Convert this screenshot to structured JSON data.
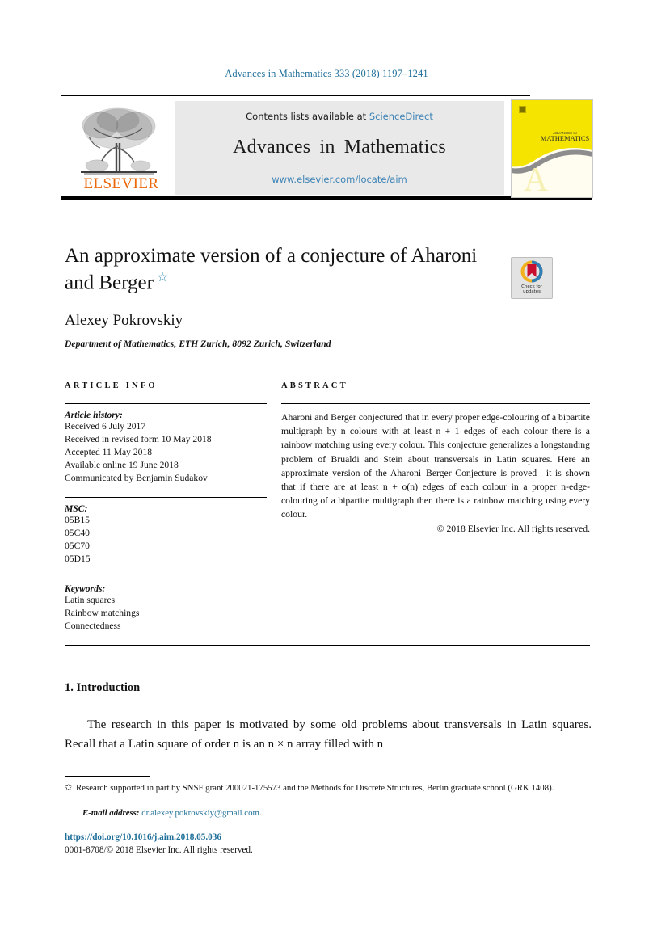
{
  "running_head": "Advances in Mathematics 333 (2018) 1197–1241",
  "masthead": {
    "contents_prefix": "Contents lists available at ",
    "sciencedirect_link": "ScienceDirect",
    "journal_name": "Advances in Mathematics",
    "journal_url": "www.elsevier.com/locate/aim",
    "publisher_logo_text": "ELSEVIER",
    "cover_title_small": "ADVANCES IN",
    "cover_title_main": "MATHEMATICS"
  },
  "article": {
    "title": "An approximate version of a conjecture of Aharoni and Berger",
    "title_footnote_marker": "☆",
    "author": "Alexey Pokrovskiy",
    "affiliation": "Department of Mathematics, ETH Zurich, 8092 Zurich, Switzerland",
    "crossmark_label_line1": "Check for",
    "crossmark_label_line2": "updates"
  },
  "article_info": {
    "heading": "ARTICLE INFO",
    "history_label": "Article history:",
    "history": [
      "Received 6 July 2017",
      "Received in revised form 10 May 2018",
      "Accepted 11 May 2018",
      "Available online 19 June 2018",
      "Communicated by Benjamin Sudakov"
    ],
    "msc_label": "MSC:",
    "msc": [
      "05B15",
      "05C40",
      "05C70",
      "05D15"
    ],
    "keywords_label": "Keywords:",
    "keywords": [
      "Latin squares",
      "Rainbow matchings",
      "Connectedness"
    ]
  },
  "abstract": {
    "heading": "ABSTRACT",
    "text": "Aharoni and Berger conjectured that in every proper edge-colouring of a bipartite multigraph by n colours with at least n + 1 edges of each colour there is a rainbow matching using every colour. This conjecture generalizes a longstanding problem of Brualdi and Stein about transversals in Latin squares. Here an approximate version of the Aharoni–Berger Conjecture is proved—it is shown that if there are at least n + o(n) edges of each colour in a proper n-edge-colouring of a bipartite multigraph then there is a rainbow matching using every colour.",
    "copyright": "© 2018 Elsevier Inc. All rights reserved."
  },
  "body": {
    "section_number_title": "1. Introduction",
    "paragraph": "The research in this paper is motivated by some old problems about transversals in Latin squares. Recall that a Latin square of order n is an n × n array filled with n"
  },
  "footnotes": {
    "star_marker": "✩",
    "funding": "Research supported in part by SNSF grant 200021-175573 and the Methods for Discrete Structures, Berlin graduate school (GRK 1408).",
    "email_label": "E-mail address:",
    "email": "dr.alexey.pokrovskiy@gmail.com",
    "email_period": "."
  },
  "footer": {
    "doi": "https://doi.org/10.1016/j.aim.2018.05.036",
    "issn_copyright": "0001-8708/© 2018 Elsevier Inc. All rights reserved."
  },
  "colors": {
    "link_blue": "#1f6f9a",
    "sciencedirect_blue": "#3b82b4",
    "elsevier_orange": "#eb6707",
    "cover_yellow": "#f5e400",
    "banner_gray": "#e9e9e9"
  }
}
